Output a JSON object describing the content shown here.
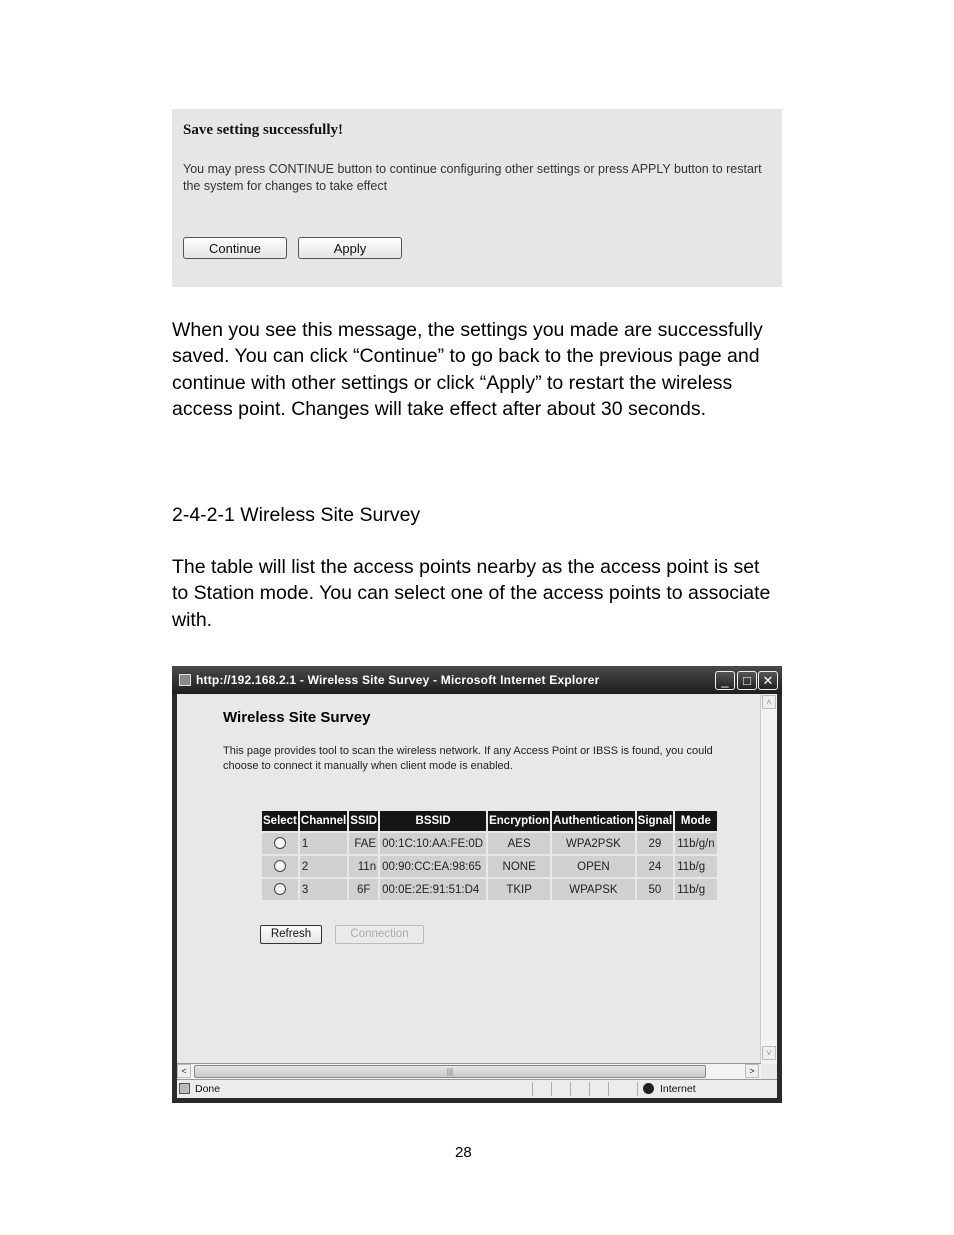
{
  "save_dialog": {
    "title": "Save setting successfully!",
    "message": "You may press CONTINUE button to continue configuring other settings or press APPLY button to restart the system for changes to take effect",
    "continue_label": "Continue",
    "apply_label": "Apply"
  },
  "paragraph1": "When you see this message, the settings you made are successfully saved. You can click “Continue” to go back to the previous page and continue with other settings or click “Apply” to restart the wireless access point. Changes will take effect after about 30 seconds.",
  "section_heading": "2-4-2-1 Wireless Site Survey",
  "paragraph2": "The table will list the access points nearby as the access point is set to Station mode. You can select one of the access points to associate with.",
  "browser": {
    "title": "http://192.168.2.1 - Wireless Site Survey - Microsoft Internet Explorer",
    "minimize_glyph": "_",
    "maximize_glyph": "□",
    "close_glyph": "✕",
    "status_text": "Done",
    "zone_text": "Internet",
    "scroll_up": "˄",
    "scroll_down": "˅",
    "scroll_left": "<",
    "scroll_right": ">",
    "thumb_grip": "|||"
  },
  "site_survey": {
    "title": "Wireless Site Survey",
    "description": "This page provides tool to scan the wireless network. If any Access Point or IBSS is found, you could choose to connect it manually when client mode is enabled.",
    "columns": [
      "Select",
      "Channel",
      "SSID",
      "BSSID",
      "Encryption",
      "Authentication",
      "Signal",
      "Mode"
    ],
    "rows": [
      {
        "channel": "1",
        "ssid": "FAE",
        "bssid": "00:1C:10:AA:FE:0D",
        "encryption": "AES",
        "authentication": "WPA2PSK",
        "signal": "29",
        "mode": "11b/g/n"
      },
      {
        "channel": "2",
        "ssid": "11n",
        "bssid": "00:90:CC:EA:98:65",
        "encryption": "NONE",
        "authentication": "OPEN",
        "signal": "24",
        "mode": "11b/g"
      },
      {
        "channel": "3",
        "ssid": "6F",
        "bssid": "00:0E:2E:91:51:D4",
        "encryption": "TKIP",
        "authentication": "WPAPSK",
        "signal": "50",
        "mode": "11b/g"
      }
    ],
    "refresh_label": "Refresh",
    "connection_label": "Connection"
  },
  "page_number": "28"
}
